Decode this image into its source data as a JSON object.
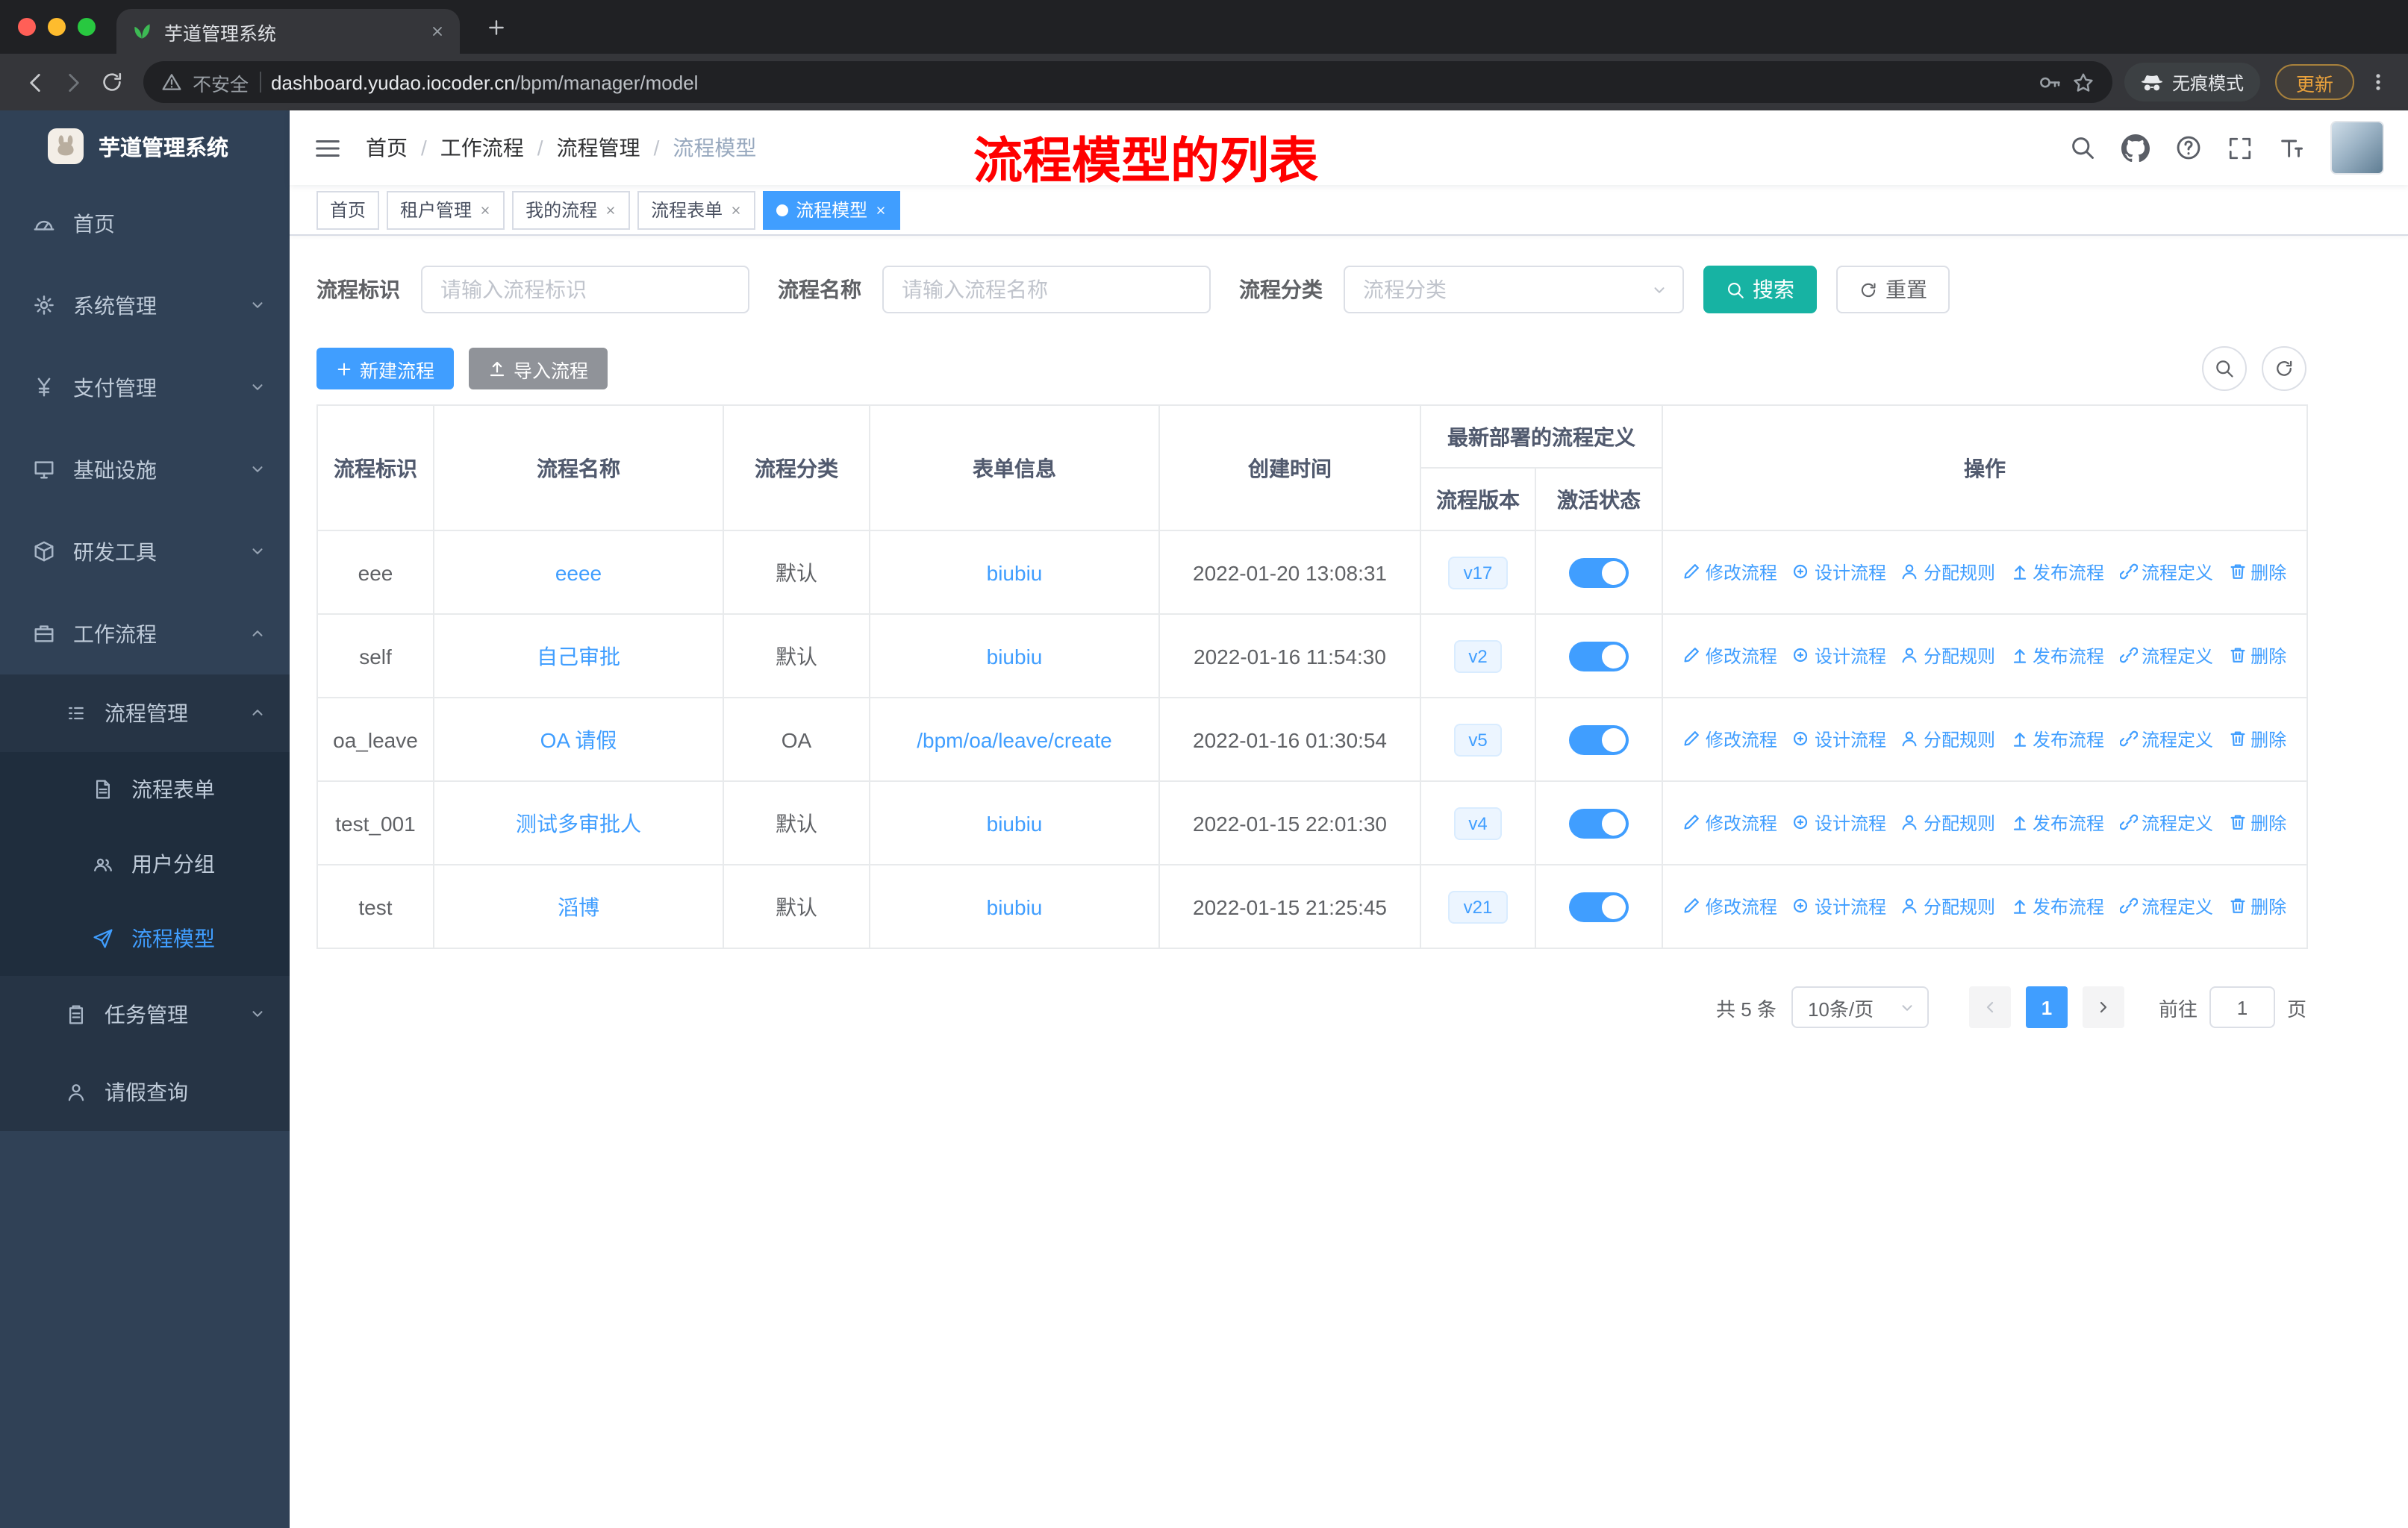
{
  "browser": {
    "tab_title": "芋道管理系统",
    "security_label": "不安全",
    "url_host": "dashboard.yudao.iocoder.cn",
    "url_path": "/bpm/manager/model",
    "incognito_label": "无痕模式",
    "update_label": "更新"
  },
  "colors": {
    "accent": "#409eff",
    "search_button": "#17b3a3",
    "sidebar_bg": "#304156",
    "annotation": "#ff0000",
    "tag_active": "#409eff"
  },
  "sidebar": {
    "logo_title": "芋道管理系统",
    "menu": [
      {
        "label": "首页",
        "icon": "dashboard-icon",
        "level": 1
      },
      {
        "label": "系统管理",
        "icon": "gear-icon",
        "level": 1,
        "chevron": "down"
      },
      {
        "label": "支付管理",
        "icon": "yen-icon",
        "level": 1,
        "chevron": "down"
      },
      {
        "label": "基础设施",
        "icon": "infra-icon",
        "level": 1,
        "chevron": "down"
      },
      {
        "label": "研发工具",
        "icon": "tools-icon",
        "level": 1,
        "chevron": "down"
      },
      {
        "label": "工作流程",
        "icon": "workflow-icon",
        "level": 1,
        "chevron": "up"
      },
      {
        "label": "流程管理",
        "icon": "process-icon",
        "level": 2,
        "chevron": "up"
      },
      {
        "label": "流程表单",
        "icon": "form-icon",
        "level": 3
      },
      {
        "label": "用户分组",
        "icon": "group-icon",
        "level": 3
      },
      {
        "label": "流程模型",
        "icon": "model-icon",
        "level": 3,
        "active": true
      },
      {
        "label": "任务管理",
        "icon": "task-icon",
        "level": 2,
        "chevron": "down"
      },
      {
        "label": "请假查询",
        "icon": "leave-icon",
        "level": 2
      }
    ]
  },
  "header": {
    "breadcrumb": [
      "首页",
      "工作流程",
      "流程管理",
      "流程模型"
    ],
    "annotation": "流程模型的列表"
  },
  "tags": [
    {
      "label": "首页"
    },
    {
      "label": "租户管理",
      "closable": true
    },
    {
      "label": "我的流程",
      "closable": true
    },
    {
      "label": "流程表单",
      "closable": true
    },
    {
      "label": "流程模型",
      "closable": true,
      "active": true
    }
  ],
  "filters": {
    "fields": [
      {
        "label": "流程标识",
        "placeholder": "请输入流程标识",
        "type": "input"
      },
      {
        "label": "流程名称",
        "placeholder": "请输入流程名称",
        "type": "input"
      },
      {
        "label": "流程分类",
        "placeholder": "流程分类",
        "type": "select"
      }
    ],
    "search_label": "搜索",
    "reset_label": "重置"
  },
  "toolbar": {
    "create_label": "新建流程",
    "import_label": "导入流程"
  },
  "table": {
    "headers": {
      "id": "流程标识",
      "name": "流程名称",
      "category": "流程分类",
      "form": "表单信息",
      "created": "创建时间",
      "group": "最新部署的流程定义",
      "version": "流程版本",
      "status": "激活状态",
      "actions": "操作"
    },
    "rows": [
      {
        "id": "eee",
        "name": "eeee",
        "category": "默认",
        "form": "biubiu",
        "created": "2022-01-20 13:08:31",
        "version": "v17",
        "active": true
      },
      {
        "id": "self",
        "name": "自己审批",
        "category": "默认",
        "form": "biubiu",
        "created": "2022-01-16 11:54:30",
        "version": "v2",
        "active": true
      },
      {
        "id": "oa_leave",
        "name": "OA 请假",
        "category": "OA",
        "form": "/bpm/oa/leave/create",
        "created": "2022-01-16 01:30:54",
        "version": "v5",
        "active": true
      },
      {
        "id": "test_001",
        "name": "测试多审批人",
        "category": "默认",
        "form": "biubiu",
        "created": "2022-01-15 22:01:30",
        "version": "v4",
        "active": true
      },
      {
        "id": "test",
        "name": "滔博",
        "category": "默认",
        "form": "biubiu",
        "created": "2022-01-15 21:25:45",
        "version": "v21",
        "active": true
      }
    ],
    "actions": [
      {
        "label": "修改流程",
        "icon": "edit-icon"
      },
      {
        "label": "设计流程",
        "icon": "design-icon"
      },
      {
        "label": "分配规则",
        "icon": "assign-icon"
      },
      {
        "label": "发布流程",
        "icon": "publish-icon"
      },
      {
        "label": "流程定义",
        "icon": "definition-icon"
      },
      {
        "label": "删除",
        "icon": "delete-icon"
      }
    ]
  },
  "pagination": {
    "total": "共 5 条",
    "page_size": "10条/页",
    "current": "1",
    "goto_label": "前往",
    "page_label": "页"
  }
}
